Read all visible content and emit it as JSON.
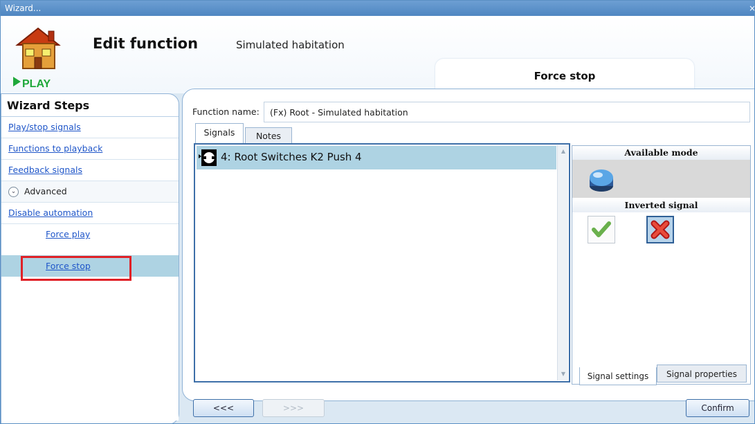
{
  "window": {
    "title": "Wizard...",
    "close_glyph": "×"
  },
  "header": {
    "title": "Edit function",
    "subtitle": "Simulated habitation",
    "active_tab": "Force stop",
    "logo_text": "PLAY"
  },
  "sidebar": {
    "title": "Wizard Steps",
    "items": [
      {
        "label": "Play/stop signals"
      },
      {
        "label": "Functions to playback"
      },
      {
        "label": "Feedback signals"
      },
      {
        "label": "Advanced"
      },
      {
        "label": "Disable automation"
      },
      {
        "label": "Force play"
      },
      {
        "label": "Force stop"
      }
    ]
  },
  "main": {
    "function_name_label": "Function name:",
    "function_name_value": "(Fx) Root - Simulated habitation",
    "tabs": [
      {
        "label": "Signals"
      },
      {
        "label": "Notes"
      }
    ],
    "signals": [
      {
        "label": "4: Root Switches K2 Push 4"
      }
    ],
    "available_mode_label": "Available mode",
    "inverted_signal_label": "Inverted signal",
    "bottom_tabs": [
      {
        "label": "Signal settings"
      },
      {
        "label": "Signal properties"
      }
    ]
  },
  "footer": {
    "prev_label": "<<<",
    "next_label": ">>>",
    "confirm_label": "Confirm"
  },
  "colors": {
    "accent": "#3d6fa8",
    "selection": "#aed3e3",
    "highlight_border": "#e02026",
    "link": "#1f56c9"
  },
  "icons": {
    "logo": "house-play-icon",
    "mode": "blue-round-button-icon",
    "inverted_off": "green-check-icon",
    "inverted_on": "red-x-icon",
    "signal": "push-button-signal-icon"
  }
}
